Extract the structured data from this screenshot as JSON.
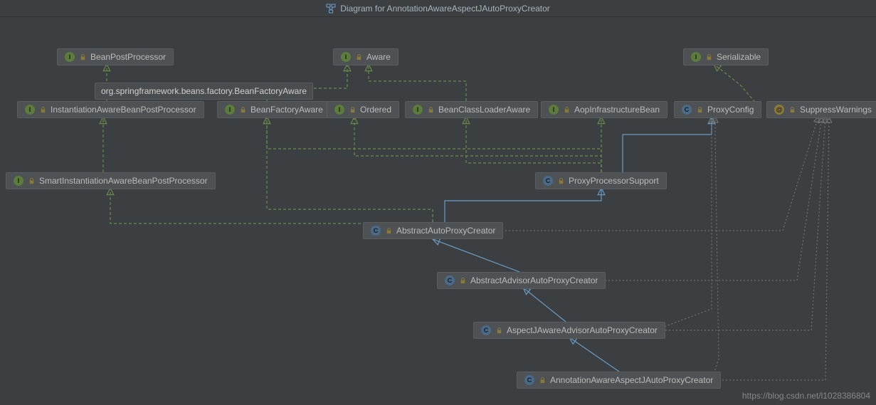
{
  "title": "Diagram for AnnotationAwareAspectJAutoProxyCreator",
  "tooltip": "org.springframework.beans.factory.BeanFactoryAware",
  "watermark": "https://blog.csdn.net/l1028386804",
  "nodes": {
    "beanPostProcessor": {
      "label": "BeanPostProcessor",
      "type": "I"
    },
    "aware": {
      "label": "Aware",
      "type": "I"
    },
    "serializable": {
      "label": "Serializable",
      "type": "I"
    },
    "instantiationAwareBPP": {
      "label": "InstantiationAwareBeanPostProcessor",
      "type": "I"
    },
    "beanFactoryAware": {
      "label": "BeanFactoryAware",
      "type": "I"
    },
    "ordered": {
      "label": "Ordered",
      "type": "I"
    },
    "beanClassLoaderAware": {
      "label": "BeanClassLoaderAware",
      "type": "I"
    },
    "aopInfraBean": {
      "label": "AopInfrastructureBean",
      "type": "I"
    },
    "proxyConfig": {
      "label": "ProxyConfig",
      "type": "C"
    },
    "suppressWarnings": {
      "label": "SuppressWarnings",
      "type": "@"
    },
    "smartInstBPP": {
      "label": "SmartInstantiationAwareBeanPostProcessor",
      "type": "I"
    },
    "proxyProcessorSupport": {
      "label": "ProxyProcessorSupport",
      "type": "C"
    },
    "abstractAutoProxyCreator": {
      "label": "AbstractAutoProxyCreator",
      "type": "C"
    },
    "abstractAdvisorAPC": {
      "label": "AbstractAdvisorAutoProxyCreator",
      "type": "C"
    },
    "aspectJAwareAPC": {
      "label": "AspectJAwareAdvisorAutoProxyCreator",
      "type": "C"
    },
    "annotationAwareAJAPC": {
      "label": "AnnotationAwareAspectJAutoProxyCreator",
      "type": "C"
    }
  }
}
